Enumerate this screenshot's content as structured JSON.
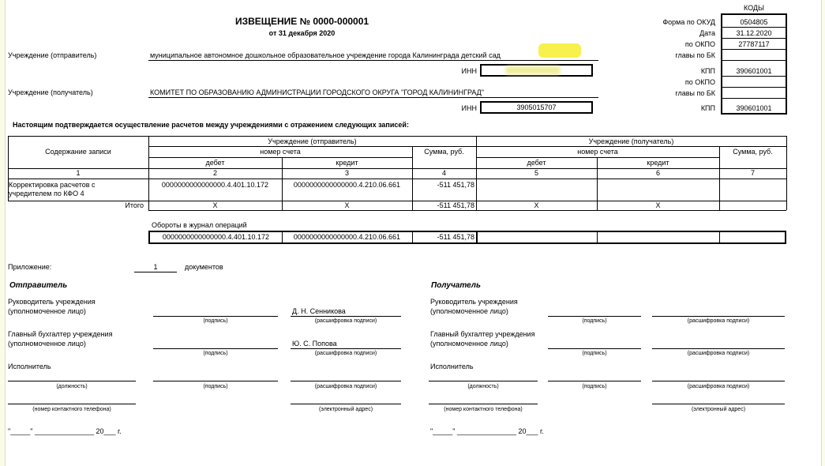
{
  "header": {
    "title": "ИЗВЕЩЕНИЕ № 0000-000001",
    "date_line": "от 31 декабря 2020"
  },
  "codes": {
    "header": "КОДЫ",
    "okud_label": "Форма по ОКУД",
    "okud_value": "0504805",
    "date_label": "Дата",
    "date_value": "31.12.2020",
    "okpo_label": "по ОКПО",
    "okpo_value": "27787117",
    "glavy_label": "главы по БК",
    "glavy_value": "",
    "kpp_label": "КПП",
    "kpp_value": "390601001",
    "okpo2_label": "по ОКПО",
    "okpo2_value": "",
    "glavy2_label": "главы по БК",
    "glavy2_value": "",
    "kpp2_label": "КПП",
    "kpp2_value": "390601001"
  },
  "sender": {
    "label": "Учреждение (отправитель)",
    "name": "муниципальное автономное дошкольное образовательное учреждение города Калининграда детский сад",
    "inn_label": "ИНН",
    "inn_value": ""
  },
  "receiver": {
    "label": "Учреждение (получатель)",
    "name": "КОМИТЕТ ПО ОБРАЗОВАНИЮ АДМИНИСТРАЦИИ ГОРОДСКОГО ОКРУГА \"ГОРОД КАЛИНИНГРАД\"",
    "inn_label": "ИНН",
    "inn_value": "3905015707"
  },
  "confirm_text": "Настоящим подтверждается осуществление расчетов между учреждениями с отражением следующих записей:",
  "table": {
    "h_content": "Содержание записи",
    "h_sender": "Учреждение (отправитель)",
    "h_receiver": "Учреждение (получатель)",
    "h_account": "номер счета",
    "h_sum": "Сумма, руб.",
    "h_debit": "дебет",
    "h_credit": "кредит",
    "nums": [
      "1",
      "2",
      "3",
      "4",
      "5",
      "6",
      "7"
    ],
    "row": {
      "content_line1": "Корректировка расчетов с",
      "content_line2": "учредителем по КФО 4",
      "debit": "0000000000000000.4.401.10.172",
      "credit": "0000000000000000.4.210.06.661",
      "sum": "-511 451,78"
    },
    "total": {
      "label": "Итого",
      "debit": "X",
      "credit": "X",
      "sum": "-511 451,78",
      "r_debit": "X",
      "r_credit": "X"
    }
  },
  "turnovers": {
    "label": "Обороты в журнал операций",
    "debit": "0000000000000000.4.401.10.172",
    "credit": "0000000000000000.4.210.06.661",
    "sum": "-511 451,78"
  },
  "attachment": {
    "label": "Приложение:",
    "count": "1",
    "unit": "документов"
  },
  "sign_sender": {
    "title": "Отправитель",
    "head_l1": "Руководитель учреждения",
    "head_l2": "(уполномоченное лицо)",
    "head_name": "Д. Н. Сенникова",
    "acc_l1": "Главный бухгалтер учреждения",
    "acc_l2": "(уполномоченное лицо)",
    "acc_name": "Ю. С. Попова",
    "exec": "Исполнитель"
  },
  "sign_receiver": {
    "title": "Получатель",
    "head_l1": "Руководитель учреждения",
    "head_l2": "(уполномоченное лицо)",
    "acc_l1": "Главный бухгалтер учреждения",
    "acc_l2": "(уполномоченное лицо)",
    "exec": "Исполнитель"
  },
  "captions": {
    "signature": "(подпись)",
    "decode": "(расшифровка подписи)",
    "position": "(должность)",
    "phone": "(номер контактного телефона)",
    "email": "(электронный адрес)",
    "date_line": "\"_____\" _______________ 20___ г."
  }
}
